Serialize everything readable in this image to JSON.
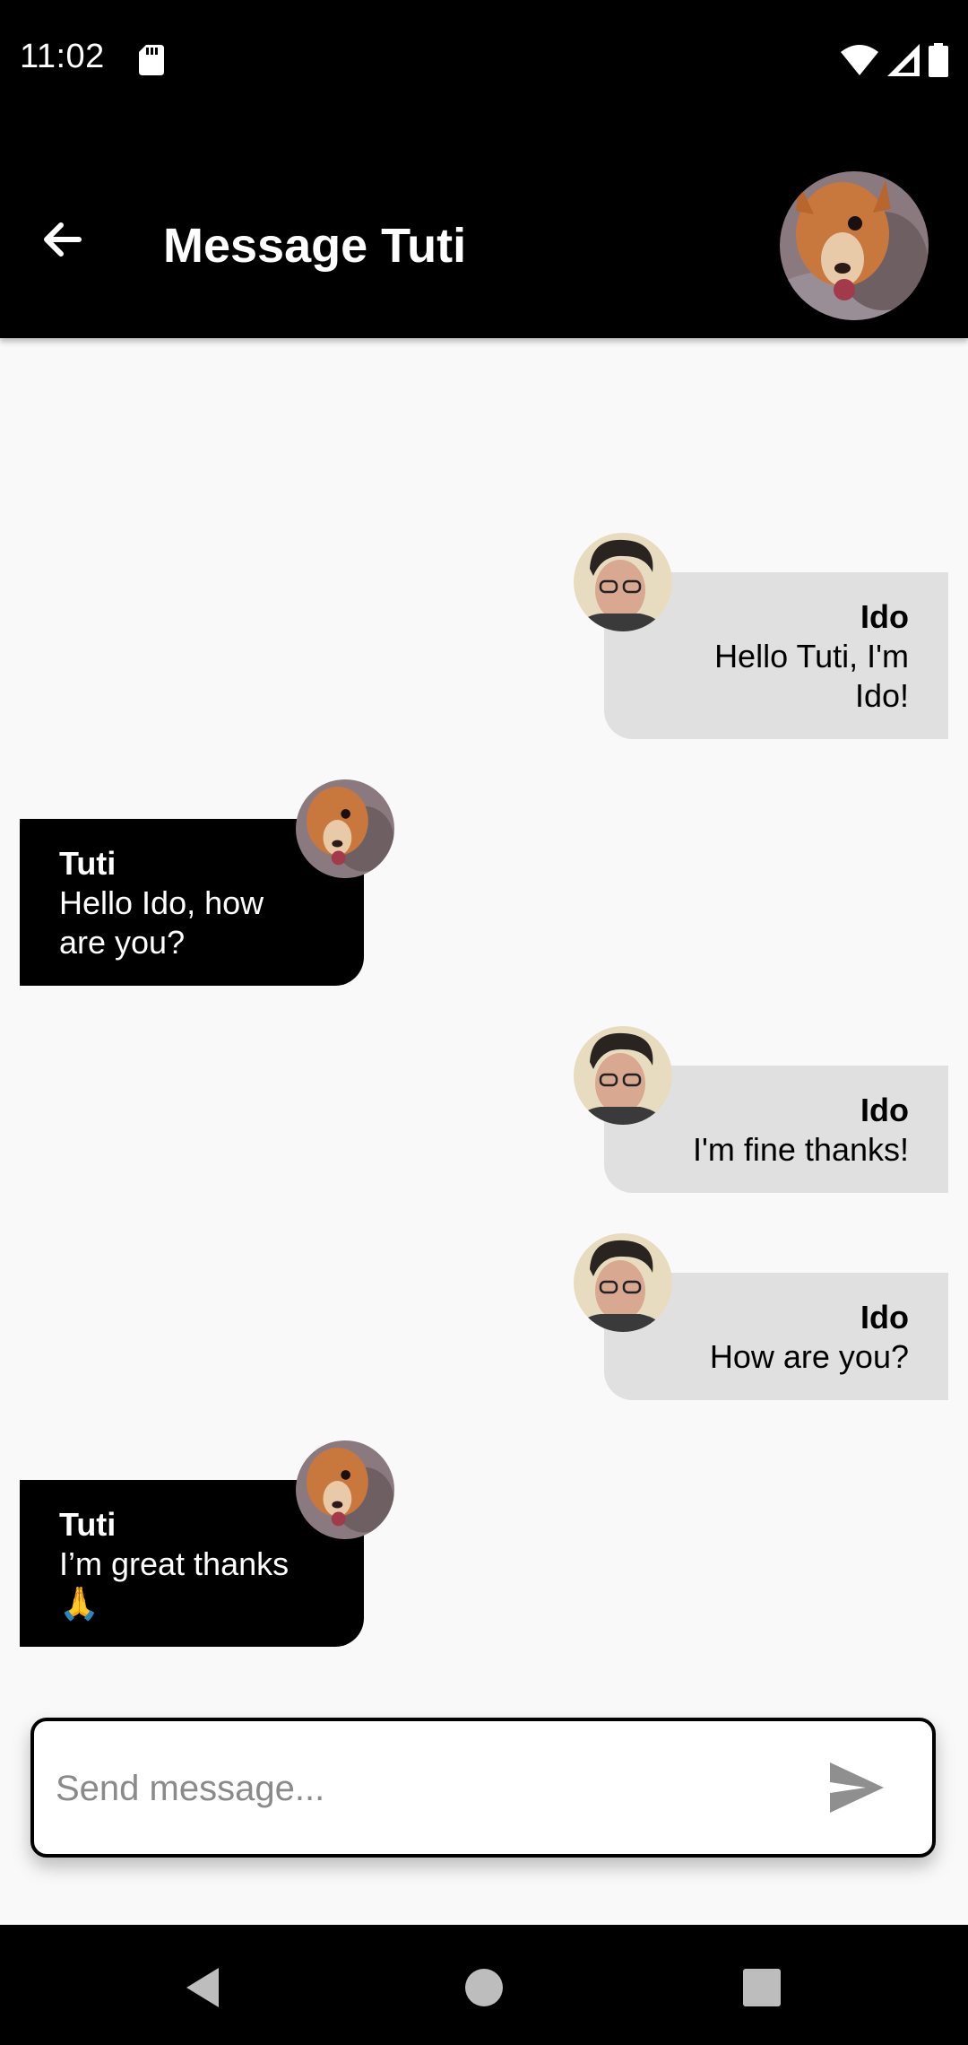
{
  "status_bar": {
    "time": "11:02",
    "icons": [
      "sd-card-icon",
      "wifi-icon",
      "cell-signal-icon",
      "battery-icon"
    ]
  },
  "header": {
    "title": "Message Tuti",
    "back_icon": "arrow-left-icon",
    "avatar": "tuti-avatar"
  },
  "messages": [
    {
      "sender": "Ido",
      "text": "Hello Tuti, I'm\nIdo!",
      "from_me": true
    },
    {
      "sender": "Tuti",
      "text": "Hello Ido, how\nare you?",
      "from_me": false
    },
    {
      "sender": "Ido",
      "text": "I'm fine thanks!",
      "from_me": true
    },
    {
      "sender": "Ido",
      "text": "How are you?",
      "from_me": true
    },
    {
      "sender": "Tuti",
      "text": "I’m great thanks\n🙏",
      "from_me": false
    }
  ],
  "composer": {
    "placeholder": "Send message...",
    "send_icon": "send-icon"
  },
  "nav_bar": {
    "icons": [
      "nav-back-icon",
      "nav-home-icon",
      "nav-recents-icon"
    ]
  },
  "colors": {
    "app_bar": "#000000",
    "my_bubble": "#e0e0e0",
    "other_bubble": "#000000",
    "background": "#f9f9f9"
  }
}
